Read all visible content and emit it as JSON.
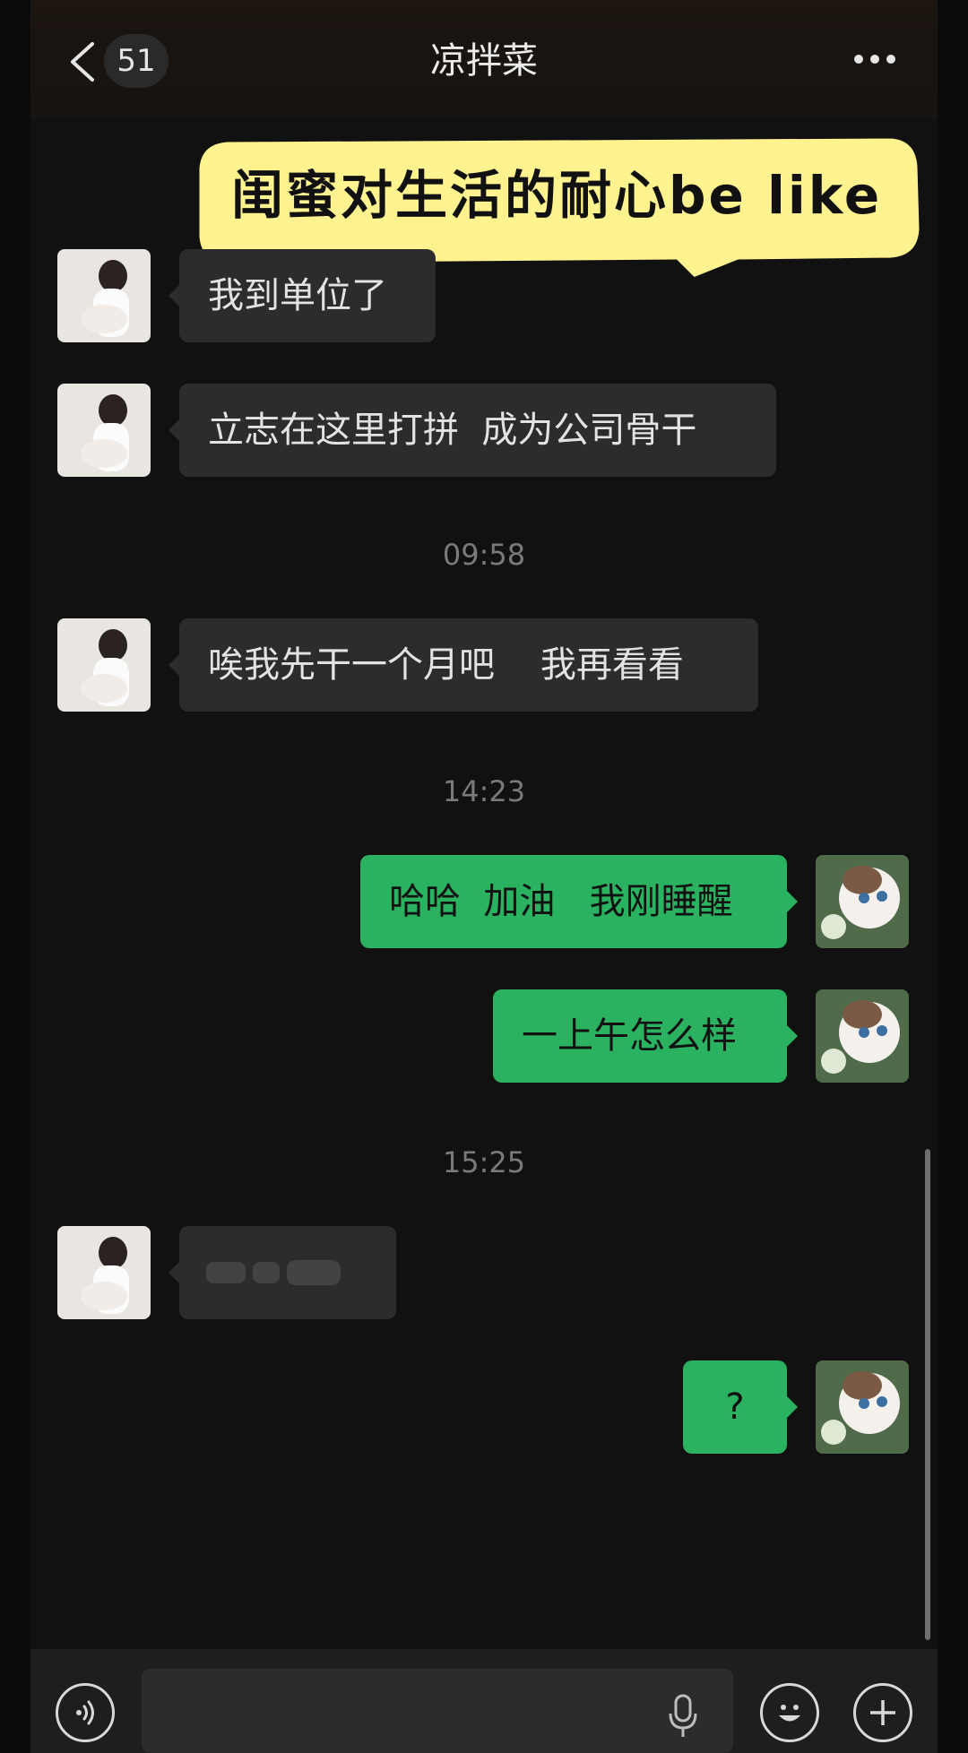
{
  "header": {
    "back_icon": "chevron-left-icon",
    "unread_count": "51",
    "title": "凉拌菜",
    "more_icon": "more-horizontal-icon"
  },
  "sticker": {
    "text": "闺蜜对生活的耐心be like"
  },
  "messages": [
    {
      "side": "in",
      "text": "我到单位了"
    },
    {
      "side": "in",
      "text": "立志在这里打拼  成为公司骨干"
    },
    {
      "side": "time",
      "text": "09:58"
    },
    {
      "side": "in",
      "text": "唉我先干一个月吧    我再看看"
    },
    {
      "side": "time",
      "text": "14:23"
    },
    {
      "side": "out",
      "text": "哈哈  加油   我刚睡醒"
    },
    {
      "side": "out",
      "text": "一上午怎么样"
    },
    {
      "side": "time",
      "text": "15:25"
    },
    {
      "side": "in",
      "text": "",
      "blurred": true
    },
    {
      "side": "out",
      "text": "?"
    }
  ],
  "input_bar": {
    "voice_icon": "voice-toggle-icon",
    "mic_icon": "mic-icon",
    "emoji_icon": "emoji-icon",
    "plus_icon": "plus-icon",
    "input_value": ""
  },
  "colors": {
    "background": "#111111",
    "incoming_bubble": "#2c2c2c",
    "outgoing_bubble": "#2bb261",
    "sticker_yellow": "#fff38f"
  }
}
